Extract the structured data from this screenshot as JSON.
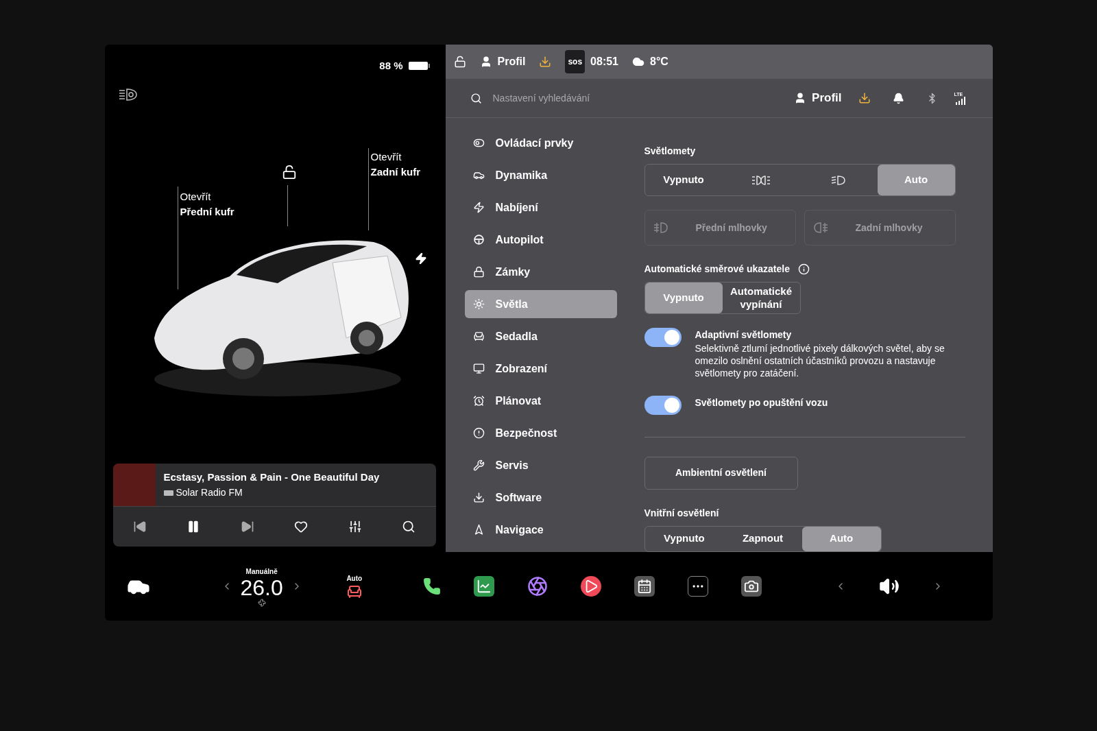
{
  "status_bar": {
    "battery": "88 %",
    "profile": "Profil",
    "sos": "sos",
    "time": "08:51",
    "temperature": "8°C"
  },
  "car_view": {
    "frunk": {
      "action": "Otevřít",
      "name": "Přední kufr"
    },
    "trunk": {
      "action": "Otevřít",
      "name": "Zadní kufr"
    }
  },
  "media": {
    "title": "Ecstasy, Passion & Pain - One Beautiful Day",
    "station": "Solar Radio FM"
  },
  "settings_header": {
    "search": {
      "placeholder": "Nastavení vyhledávání"
    },
    "profile": "Profil",
    "network": "LTE"
  },
  "sidebar": {
    "items": [
      {
        "kind": "controls",
        "label": "Ovládací prvky",
        "selected": false
      },
      {
        "kind": "dynamics",
        "label": "Dynamika",
        "selected": false
      },
      {
        "kind": "charging",
        "label": "Nabíjení",
        "selected": false
      },
      {
        "kind": "autopilot",
        "label": "Autopilot",
        "selected": false
      },
      {
        "kind": "locks",
        "label": "Zámky",
        "selected": false
      },
      {
        "kind": "lights",
        "label": "Světla",
        "selected": true
      },
      {
        "kind": "seats",
        "label": "Sedadla",
        "selected": false
      },
      {
        "kind": "display",
        "label": "Zobrazení",
        "selected": false
      },
      {
        "kind": "schedule",
        "label": "Plánovat",
        "selected": false
      },
      {
        "kind": "safety",
        "label": "Bezpečnost",
        "selected": false
      },
      {
        "kind": "service",
        "label": "Servis",
        "selected": false
      },
      {
        "kind": "software",
        "label": "Software",
        "selected": false
      },
      {
        "kind": "navigation",
        "label": "Navigace",
        "selected": false
      }
    ]
  },
  "headlights": {
    "title": "Světlomety",
    "options": [
      {
        "kind": "text",
        "label": "Vypnuto",
        "selected": false
      },
      {
        "kind": "parking",
        "selected": false
      },
      {
        "kind": "lowbeam",
        "selected": false
      },
      {
        "kind": "text",
        "label": "Auto",
        "selected": true
      }
    ]
  },
  "fog_lights": [
    {
      "kind": "front",
      "label": "Přední mlhovky",
      "disabled": true
    },
    {
      "kind": "rear",
      "label": "Zadní mlhovky",
      "disabled": true
    }
  ],
  "auto_turn_signals": {
    "title": "Automatické směrové ukazatele",
    "options": [
      {
        "label": "Vypnuto",
        "selected": true
      },
      {
        "label": "Automatické vypínání",
        "selected": false
      }
    ]
  },
  "toggles": [
    {
      "title": "Adaptivní světlomety",
      "description": "Selektivně ztlumí jednotlivé pixely dálkových světel, aby se omezilo oslnění ostatních účastníků provozu a nastavuje světlomety pro zatáčení.",
      "on": true
    },
    {
      "title": "Světlomety po opuštění vozu",
      "on": true
    }
  ],
  "ambient_button": "Ambientní osvětlení",
  "interior_lights": {
    "title": "Vnitřní osvětlení",
    "options": [
      {
        "label": "Vypnuto",
        "selected": false
      },
      {
        "label": "Zapnout",
        "selected": false
      },
      {
        "label": "Auto",
        "selected": true
      }
    ]
  },
  "climate": {
    "mode": "Manuálně",
    "temperature": "26.0",
    "seat_heater": "Auto"
  }
}
